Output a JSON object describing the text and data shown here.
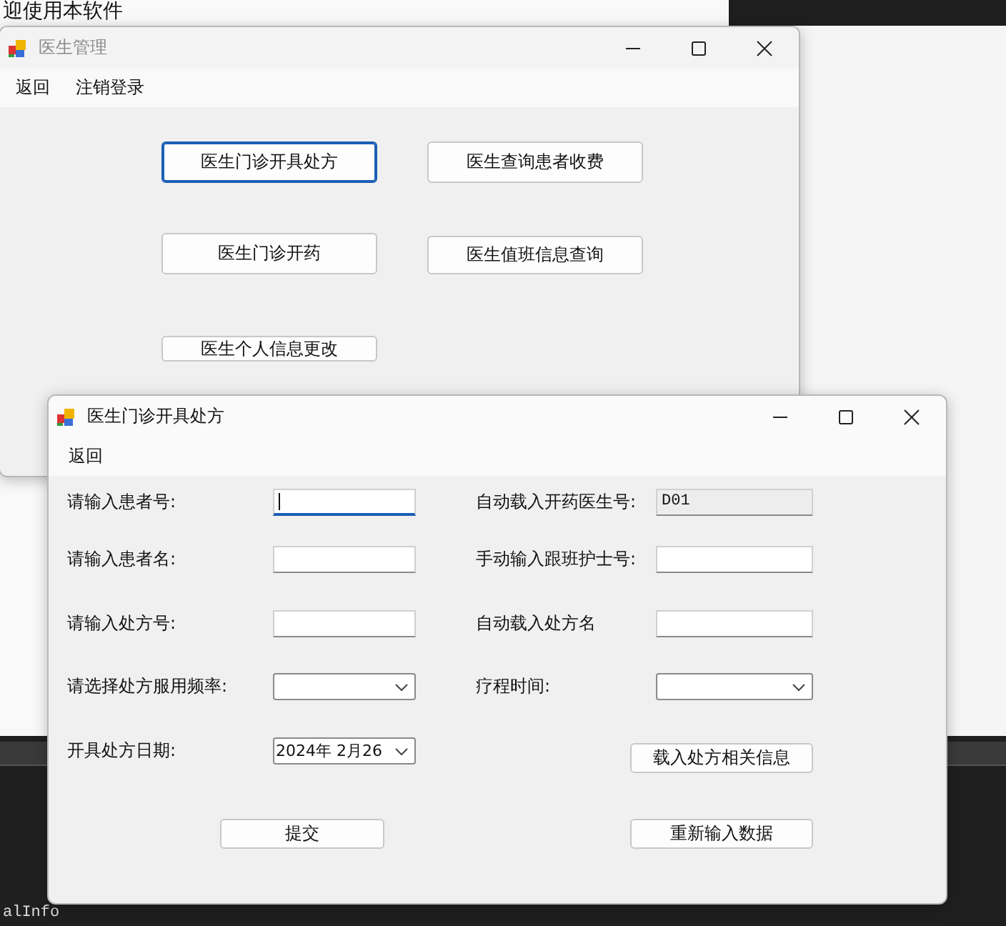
{
  "background_window": {
    "heading": "迎使用本软件"
  },
  "background_console": {
    "text": "alInfo"
  },
  "main_window": {
    "title": "医生管理",
    "active": false,
    "menu": [
      "返回",
      "注销登录"
    ],
    "buttons": [
      {
        "label": "医生门诊开具处方",
        "focused": true
      },
      {
        "label": "医生查询患者收费",
        "focused": false
      },
      {
        "label": "医生门诊开药",
        "focused": false
      },
      {
        "label": "医生值班信息查询",
        "focused": false
      },
      {
        "label": "医生个人信息更改",
        "focused": false
      }
    ]
  },
  "prescription_window": {
    "title": "医生门诊开具处方",
    "active": true,
    "menu": [
      "返回"
    ],
    "rows": [
      {
        "cells": [
          {
            "label": "请输入患者号:",
            "kind": "text",
            "focused": true
          },
          {
            "label": "自动载入开药医生号:",
            "kind": "readonly",
            "value": "D01"
          }
        ]
      },
      {
        "cells": [
          {
            "label": "请输入患者名:",
            "kind": "text",
            "focused": false
          },
          {
            "label": "手动输入跟班护士号:",
            "kind": "text",
            "focused": false
          }
        ]
      },
      {
        "cells": [
          {
            "label": "请输入处方号:",
            "kind": "text",
            "focused": false
          },
          {
            "label": "自动载入处方名",
            "kind": "text",
            "focused": false
          }
        ]
      },
      {
        "cells": [
          {
            "label": "请选择处方服用频率:",
            "kind": "combo"
          },
          {
            "label": "疗程时间:",
            "kind": "combo"
          }
        ]
      },
      {
        "cells": [
          {
            "label": "开具处方日期:",
            "kind": "date",
            "value": "2024年 2月26"
          },
          {
            "label": "载入处方相关信息",
            "kind": "button"
          }
        ]
      }
    ],
    "buttons": [
      "提交",
      "重新输入数据"
    ]
  }
}
